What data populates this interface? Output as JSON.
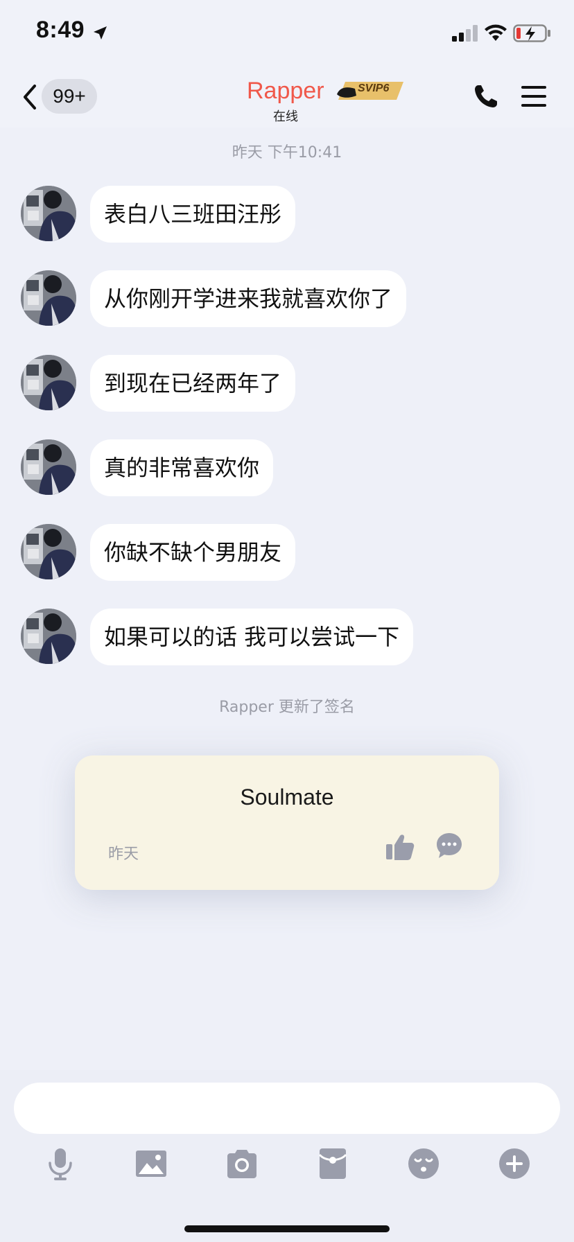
{
  "status_bar": {
    "time": "8:49",
    "icons": [
      "location-arrow-icon",
      "cellular-signal-icon",
      "wifi-icon",
      "battery-charging-icon"
    ]
  },
  "nav": {
    "unread_count": "99+",
    "contact_name": "Rapper",
    "vip_badge": "SVIP6",
    "status": "在线",
    "icons": [
      "back-chevron-icon",
      "phone-icon",
      "menu-icon"
    ]
  },
  "chat": {
    "timestamp": "昨天 下午10:41",
    "messages": [
      {
        "text": "表白八三班田汪彤"
      },
      {
        "text": "从你刚开学进来我就喜欢你了"
      },
      {
        "text": "到现在已经两年了"
      },
      {
        "text": "真的非常喜欢你"
      },
      {
        "text": "你缺不缺个男朋友"
      },
      {
        "text": "如果可以的话 我可以尝试一下"
      }
    ],
    "system_note": "Rapper 更新了签名",
    "signature_card": {
      "text": "Soulmate",
      "date": "昨天"
    }
  },
  "input": {
    "value": "",
    "placeholder": ""
  },
  "toolbar": {
    "items": [
      "microphone-icon",
      "image-icon",
      "camera-icon",
      "red-packet-icon",
      "emoji-icon",
      "plus-icon"
    ]
  },
  "colors": {
    "background": "#eef0f8",
    "name_accent": "#f0584a",
    "svip_gold": "#e8c06a",
    "bubble": "#ffffff",
    "signature_card": "#f8f4e4",
    "icon_gray": "#9a9dab"
  }
}
